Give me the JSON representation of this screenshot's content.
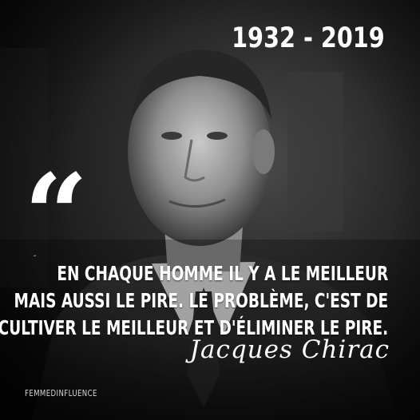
{
  "header": {
    "dates": "1932 - 2019"
  },
  "quote": {
    "mark": "“",
    "small_mark": "“",
    "lines": [
      "EN CHAQUE HOMME IL Y A LE MEILLEUR",
      "MAIS AUSSI LE PIRE. LE PROBLÈME, C'EST DE",
      "CULTIVER LE MEILLEUR ET D'ÉLIMINER LE PIRE."
    ]
  },
  "signature": {
    "text": "Jacques Chirac"
  },
  "footer": {
    "brand": "FEMMEDINFLUENCE"
  },
  "colors": {
    "text": "#ffffff",
    "background": "#1a1a1a"
  }
}
